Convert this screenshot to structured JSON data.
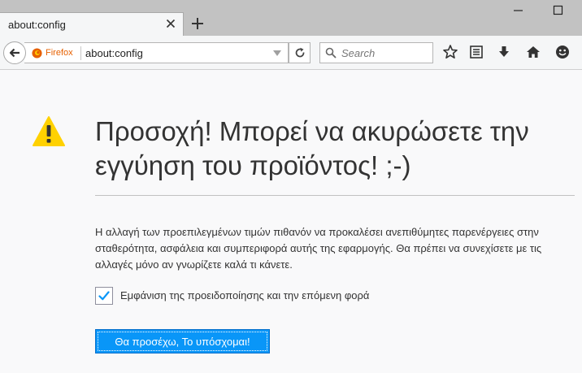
{
  "tab": {
    "title": "about:config"
  },
  "navbar": {
    "identity_label": "Firefox",
    "url": "about:config",
    "search_placeholder": "Search"
  },
  "icons": {
    "tab_close": "close-icon",
    "new_tab": "plus-icon",
    "minimize": "minimize-icon",
    "maximize": "maximize-icon",
    "back": "back-arrow-icon",
    "firefox": "firefox-icon",
    "dropdown": "chevron-down-icon",
    "reload": "reload-icon",
    "search": "search-icon",
    "bookmark": "star-icon",
    "reading_list": "library-icon",
    "downloads": "download-icon",
    "home": "home-icon",
    "hello": "smiley-icon",
    "warning": "warning-icon"
  },
  "content": {
    "title": "Προσοχή! Μπορεί να ακυρώσετε την εγγύηση του προϊόντος! ;-)",
    "warning_text": "Η αλλαγή των προεπιλεγμένων τιμών πιθανόν να προκαλέσει ανεπιθύμητες παρενέργειες στην σταθερότητα, ασφάλεια και συμπεριφορά αυτής της εφαρμογής. Θα πρέπει να συνεχίσετε με τις αλλαγές μόνο αν γνωρίζετε καλά τι κάνετε.",
    "show_warning_label": "Εμφάνιση της προειδοποίησης και την επόμενη φορά",
    "show_warning_checked": true,
    "accept_button": "Θα προσέχω, Το υπόσχομαι!"
  },
  "colors": {
    "accent": "#0996f8",
    "warning": "#ffd100",
    "checkmark": "#0996f8",
    "firefox_orange": "#e66000"
  }
}
